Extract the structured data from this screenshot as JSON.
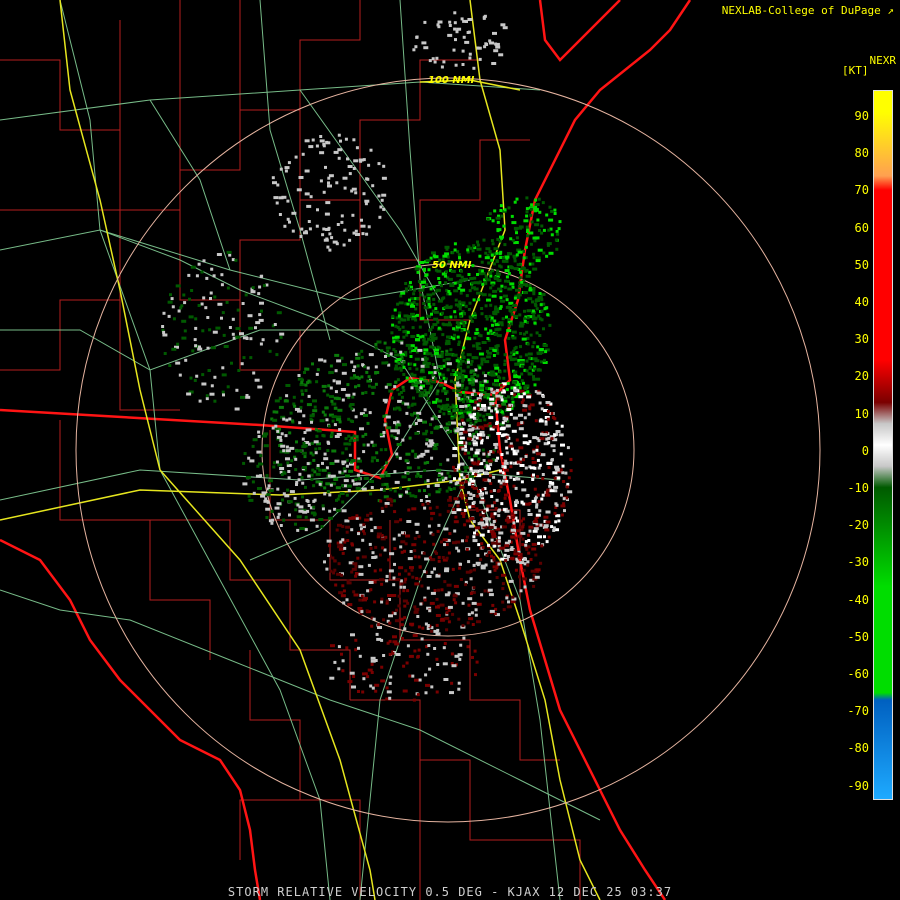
{
  "header": {
    "credit": "NEXLAB-College of DuPage",
    "product": "NEXR",
    "units": "[KT]"
  },
  "footer": {
    "caption": "STORM RELATIVE VELOCITY 0.5 DEG - KJAX 12 DEC 25 03:37"
  },
  "rings": [
    {
      "label": "50 NMI"
    },
    {
      "label": "100 NMI"
    }
  ],
  "legend": {
    "ticks": [
      "90",
      "80",
      "70",
      "60",
      "50",
      "40",
      "30",
      "20",
      "10",
      "0",
      "-10",
      "-20",
      "-30",
      "-40",
      "-50",
      "-60",
      "-70",
      "-80",
      "-90"
    ],
    "colors": {
      "yellow": "#ffff00",
      "orange": "#ffa050",
      "red": "#ff0000",
      "dark_red": "#7a0000",
      "gray": "#c8c8c8",
      "dark_green": "#005a00",
      "green": "#00dd00",
      "blue": "#0060c0",
      "light_blue": "#1eaaff"
    }
  },
  "map_colors": {
    "county_lines": "#b41e1e",
    "state_lines": "#ff1414",
    "highways": "#e6e61e",
    "roads": "#8cdca0",
    "range_rings": "#e6b4a0"
  }
}
